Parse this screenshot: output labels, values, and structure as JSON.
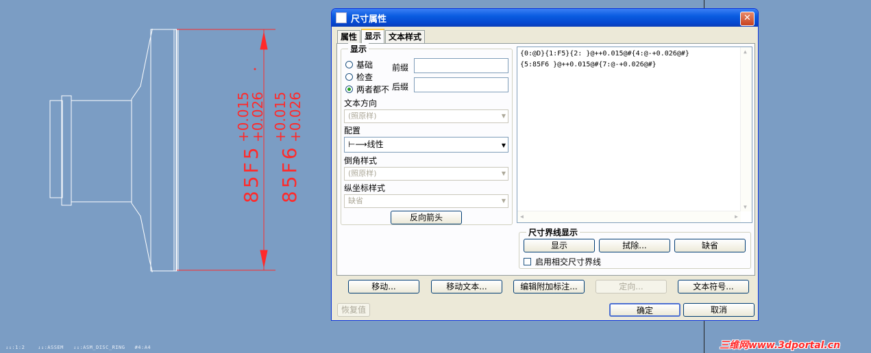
{
  "drawing": {
    "dim_main_1": "85F5",
    "dim_tol_1a": "+0.015",
    "dim_tol_1b": "+0.026",
    "dim_main_2": "85F6",
    "dim_tol_2a": "+0.015",
    "dim_tol_2b": "+0.026"
  },
  "status_bar": "↓↓:1:2    ↓↓:ASSEM   ↓↓:ASM_DISC_RING   #4:A4",
  "watermark": "三维网www.3dportal.cn",
  "dialog": {
    "title": "尺寸属性",
    "tabs": [
      "属性",
      "显示",
      "文本样式"
    ],
    "display_group": {
      "label": "显示",
      "radios": [
        "基础",
        "检查",
        "两者都不"
      ],
      "prefix_label": "前缀",
      "prefix_value": "",
      "suffix_label": "后缀",
      "suffix_value": "",
      "text_direction_label": "文本方向",
      "text_direction_value": "(照原样)",
      "config_label": "配置",
      "config_value": "线性",
      "chamfer_label": "倒角样式",
      "chamfer_value": "(照原样)",
      "ordinate_label": "纵坐标样式",
      "ordinate_value": "缺省",
      "flip_arrows": "反向箭头"
    },
    "text_lines": [
      "{0:@D}{1:F5}{2: }@++0.015@#{4:@-+0.026@#}",
      "{5:85F6 }@++0.015@#{7:@-+0.026@#}"
    ],
    "witness_group": {
      "label": "尺寸界线显示",
      "show": "显示",
      "erase": "拭除...",
      "default": "缺省",
      "intersect_label": "启用相交尺寸界线"
    },
    "buttons": {
      "move": "移动...",
      "move_text": "移动文本...",
      "edit_attach": "编辑附加标注...",
      "orient": "定向...",
      "text_symbol": "文本符号...",
      "restore": "恢复值",
      "ok": "确定",
      "cancel": "取消"
    }
  },
  "colors": {
    "background": "#7b9dc4",
    "dimension": "#ff2a2a",
    "geometry": "#ffffff"
  }
}
